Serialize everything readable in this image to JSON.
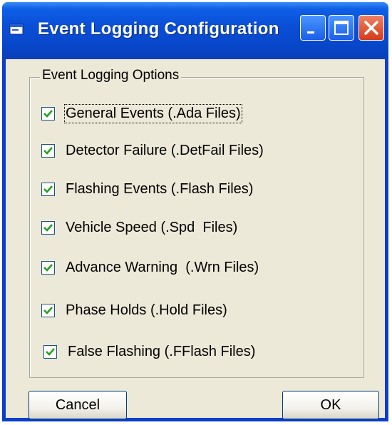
{
  "window": {
    "title": "Event Logging Configuration",
    "app_icon": "window-app-icon",
    "controls": [
      "minimize-icon",
      "maximize-icon",
      "close-icon"
    ],
    "colors": {
      "titlebar": "#0a4fd8",
      "close": "#d43c18",
      "client": "#ece9d8"
    }
  },
  "group": {
    "label": "Event Logging Options",
    "options": [
      {
        "label": "General Events (.Ada Files)",
        "checked": true,
        "focused": true
      },
      {
        "label": "Detector Failure (.DetFail Files)",
        "checked": true
      },
      {
        "label": "Flashing Events (.Flash Files)",
        "checked": true
      },
      {
        "label": "Vehicle Speed (.Spd  Files)",
        "checked": true
      },
      {
        "label": "Advance Warning  (.Wrn Files)",
        "checked": true
      },
      {
        "label": "Phase Holds (.Hold Files)",
        "checked": true
      },
      {
        "label": "False Flashing (.FFlash Files)",
        "checked": true
      }
    ]
  },
  "buttons": {
    "cancel": "Cancel",
    "ok": "OK"
  }
}
